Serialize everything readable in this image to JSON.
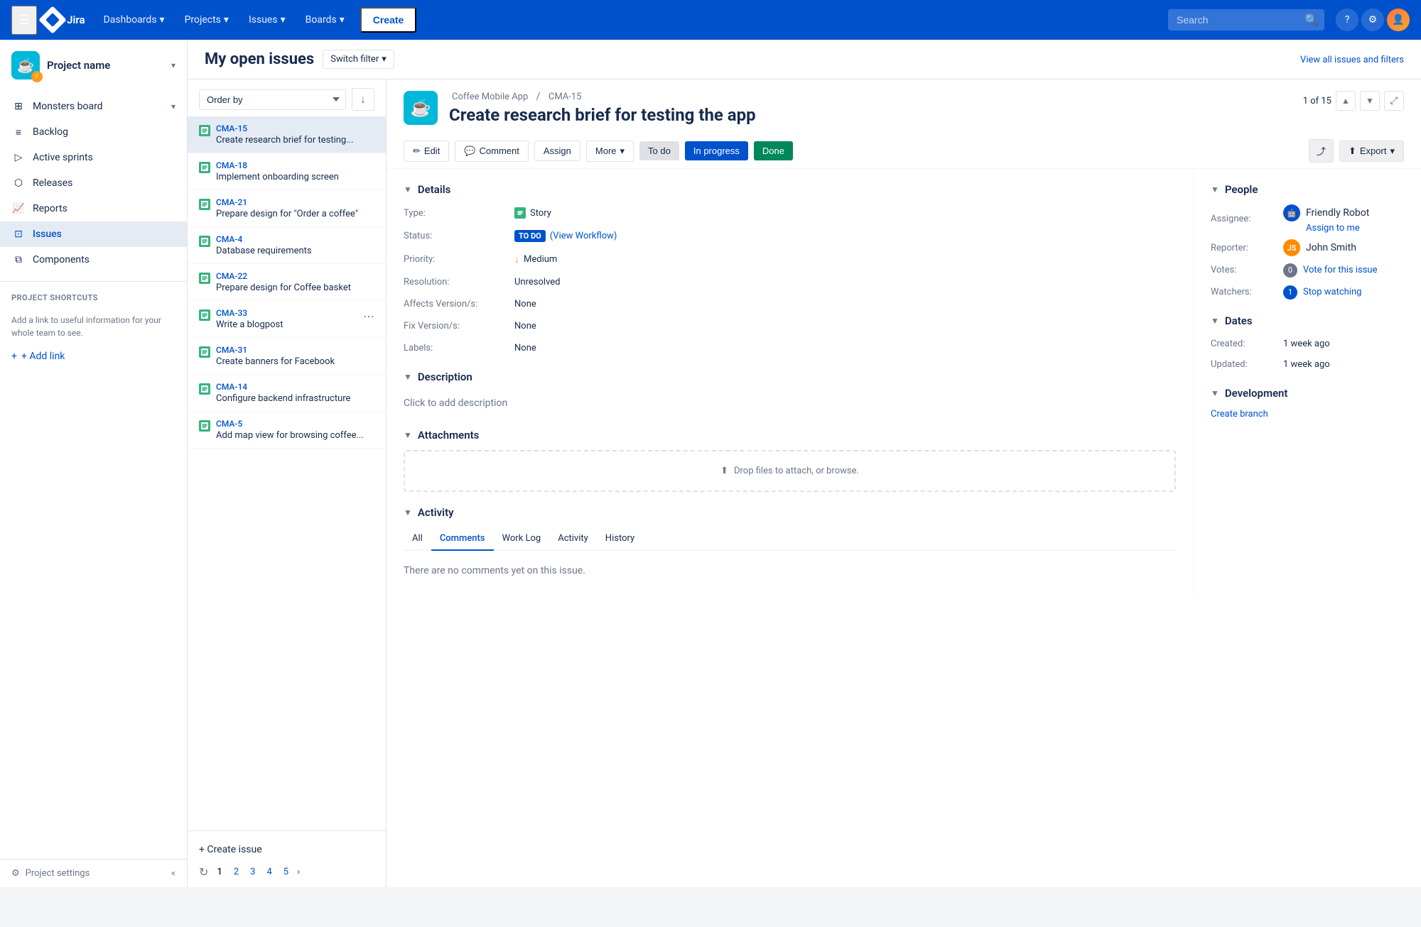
{
  "topnav": {
    "logo_text": "Jira",
    "dashboards": "Dashboards",
    "projects": "Projects",
    "issues": "Issues",
    "boards": "Boards",
    "create": "Create",
    "search_placeholder": "Search",
    "help_icon": "?",
    "settings_icon": "⚙",
    "view_all_link": "View all issues and filters"
  },
  "sidebar": {
    "project_name": "Project name",
    "project_emoji": "☕",
    "nav_items": [
      {
        "id": "monsters-board",
        "label": "Monsters board",
        "icon": "⊞",
        "has_chevron": true
      },
      {
        "id": "backlog",
        "label": "Backlog",
        "icon": "≡"
      },
      {
        "id": "active-sprints",
        "label": "Active sprints",
        "icon": "▶"
      },
      {
        "id": "releases",
        "label": "Releases",
        "icon": "⬡"
      },
      {
        "id": "reports",
        "label": "Reports",
        "icon": "📈"
      },
      {
        "id": "issues",
        "label": "Issues",
        "icon": "⊡",
        "active": true
      },
      {
        "id": "components",
        "label": "Components",
        "icon": "⧉"
      }
    ],
    "project_shortcuts_label": "PROJECT SHORTCUTS",
    "shortcuts_text": "Add a link to useful information for your whole team to see.",
    "add_link_label": "+ Add link",
    "footer": {
      "settings_label": "Project settings",
      "collapse_icon": "«"
    }
  },
  "issue_list": {
    "title": "My open issues",
    "switch_filter": "Switch filter",
    "order_by": "Order by",
    "sort_icon": "↓",
    "issues": [
      {
        "id": "CMA-15",
        "title": "Create research brief for testing...",
        "selected": true
      },
      {
        "id": "CMA-18",
        "title": "Implement onboarding screen",
        "selected": false
      },
      {
        "id": "CMA-21",
        "title": "Prepare design for \"Order a coffee\"",
        "selected": false
      },
      {
        "id": "CMA-4",
        "title": "Database requirements",
        "selected": false
      },
      {
        "id": "CMA-22",
        "title": "Prepare design for Coffee basket",
        "selected": false
      },
      {
        "id": "CMA-33",
        "title": "Write a blogpost",
        "selected": false,
        "has_more": true
      },
      {
        "id": "CMA-31",
        "title": "Create banners for Facebook",
        "selected": false
      },
      {
        "id": "CMA-14",
        "title": "Configure backend infrastructure",
        "selected": false
      },
      {
        "id": "CMA-5",
        "title": "Add map view for browsing coffee...",
        "selected": false
      }
    ],
    "create_issue": "+ Create issue",
    "pagination": {
      "pages": [
        "1",
        "2",
        "3",
        "4",
        "5"
      ],
      "current": "1",
      "next": "›"
    }
  },
  "issue_detail": {
    "breadcrumb_project": "Coffee Mobile App",
    "breadcrumb_separator": "/",
    "breadcrumb_id": "CMA-15",
    "title": "Create research brief for testing the app",
    "nav_count": "1 of 15",
    "toolbar": {
      "edit": "Edit",
      "comment": "Comment",
      "assign": "Assign",
      "more": "More",
      "more_chevron": "▾",
      "status_todo": "To do",
      "status_inprogress": "In progress",
      "status_done": "Done",
      "export": "Export"
    },
    "details": {
      "section_label": "Details",
      "type_label": "Type:",
      "type_value": "Story",
      "status_label": "Status:",
      "status_badge": "TO DO",
      "status_workflow": "(View Workflow)",
      "priority_label": "Priority:",
      "priority_value": "Medium",
      "resolution_label": "Resolution:",
      "resolution_value": "Unresolved",
      "affects_label": "Affects Version/s:",
      "affects_value": "None",
      "fix_label": "Fix Version/s:",
      "fix_value": "None",
      "labels_label": "Labels:",
      "labels_value": "None"
    },
    "people": {
      "section_label": "People",
      "assignee_label": "Assignee:",
      "assignee_name": "Friendly Robot",
      "assign_to_me": "Assign to me",
      "reporter_label": "Reporter:",
      "reporter_name": "John Smith",
      "votes_label": "Votes:",
      "votes_count": "0",
      "vote_link": "Vote for this issue",
      "watchers_label": "Watchers:",
      "watchers_count": "1",
      "watch_link": "Stop watching"
    },
    "description": {
      "section_label": "Description",
      "placeholder": "Click to add description"
    },
    "attachments": {
      "section_label": "Attachments",
      "dropzone": "Drop files to attach, or browse."
    },
    "activity": {
      "section_label": "Activity",
      "tabs": [
        "All",
        "Comments",
        "Work Log",
        "Activity",
        "History"
      ],
      "active_tab": "Comments",
      "no_comments": "There are no comments yet on this issue."
    },
    "dates": {
      "section_label": "Dates",
      "created_label": "Created:",
      "created_value": "1 week ago",
      "updated_label": "Updated:",
      "updated_value": "1 week ago"
    },
    "development": {
      "section_label": "Development",
      "create_branch": "Create branch"
    }
  }
}
